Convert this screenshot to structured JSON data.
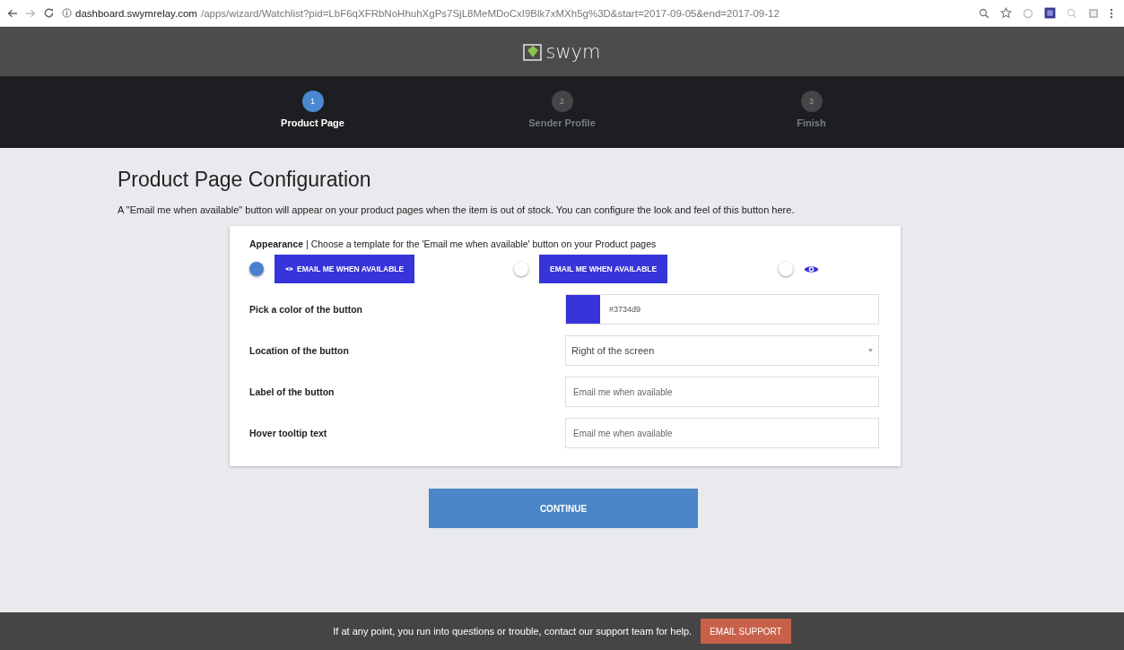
{
  "browser": {
    "url_host": "dashboard.swymrelay.com",
    "url_path": "/apps/wizard/Watchlist?pid=LbF6qXFRbNoHhuhXgPs7SjL8MeMDoCxI9Blk7xMXh5g%3D&start=2017-09-05&end=2017-09-12"
  },
  "brand": {
    "name": "swym"
  },
  "steps": [
    {
      "number": "1",
      "label": "Product Page",
      "selected": true
    },
    {
      "number": "2",
      "label": "Sender Profile",
      "selected": false
    },
    {
      "number": "3",
      "label": "Finish",
      "selected": false
    }
  ],
  "page": {
    "title": "Product Page Configuration",
    "description": "A \"Email me when available\" button will appear on your product pages when the item is out of stock. You can configure the look and feel of this button here."
  },
  "appearance": {
    "text": "**Appearance** | Choose a template for the 'Email me when available' button on your Product pages",
    "templates": [
      {
        "kind": "icon-text",
        "label": "EMAIL ME WHEN AVAILABLE",
        "selected": true
      },
      {
        "kind": "text",
        "label": "EMAIL ME WHEN AVAILABLE",
        "selected": false
      },
      {
        "kind": "icon",
        "selected": false
      }
    ]
  },
  "fields": [
    {
      "kind": "color",
      "label": "Pick a color of the button",
      "value": "#3734d9",
      "color": "#3734d9"
    },
    {
      "kind": "select",
      "label": "Location of the button",
      "value": "Right of the screen"
    },
    {
      "kind": "text",
      "label": "Label of the button",
      "placeholder": "Email me when available"
    },
    {
      "kind": "text",
      "label": "Hover tooltip text",
      "placeholder": "Email me when available"
    }
  ],
  "continue_button": "CONTINUE",
  "footer": {
    "text": "If at any point, you run into questions or trouble, contact our support team for help.",
    "button": "EMAIL SUPPORT"
  }
}
